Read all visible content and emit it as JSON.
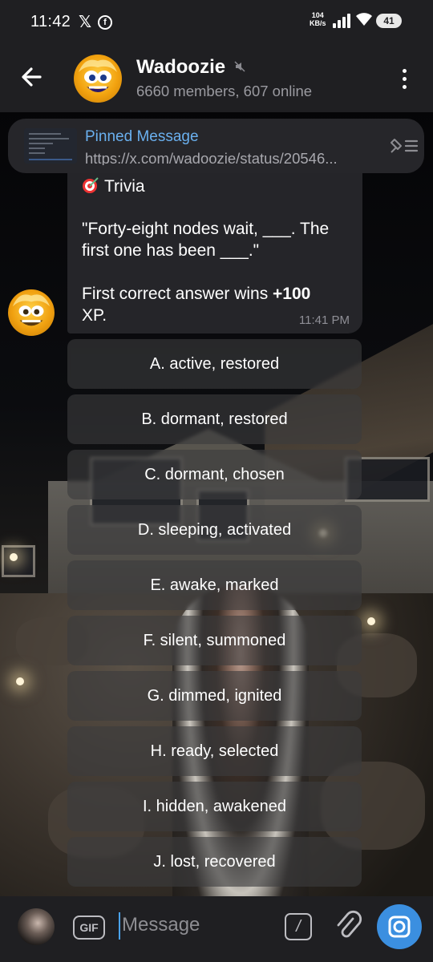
{
  "status_bar": {
    "time": "11:42",
    "network_speed": "104",
    "network_unit": "KB/s",
    "battery": "41"
  },
  "header": {
    "title": "Wadoozie",
    "subtitle": "6660 members, 607 online"
  },
  "pinned": {
    "label": "Pinned Message",
    "url": "https://x.com/wadoozie/status/20546..."
  },
  "message": {
    "title": "Trivia",
    "question_line1": "\"Forty-eight nodes wait, ___. The",
    "question_line2": "first one has been ___.\"",
    "prize_prefix": "First correct answer wins ",
    "prize_value": "+100",
    "prize_suffix": "XP.",
    "time": "11:41 PM"
  },
  "answers": [
    "A. active, restored",
    "B. dormant, restored",
    "C. dormant, chosen",
    "D. sleeping, activated",
    "E. awake, marked",
    "F. silent, summoned",
    "G. dimmed, ignited",
    "H. ready, selected",
    "I. hidden, awakened",
    "J. lost, recovered"
  ],
  "input": {
    "placeholder": "Message",
    "gif_label": "GIF",
    "command_label": "/"
  },
  "colors": {
    "accent": "#3b8fe0",
    "link": "#6ab0ef",
    "bar_bg": "#1f1f22",
    "bubble_bg": "#26262a"
  }
}
